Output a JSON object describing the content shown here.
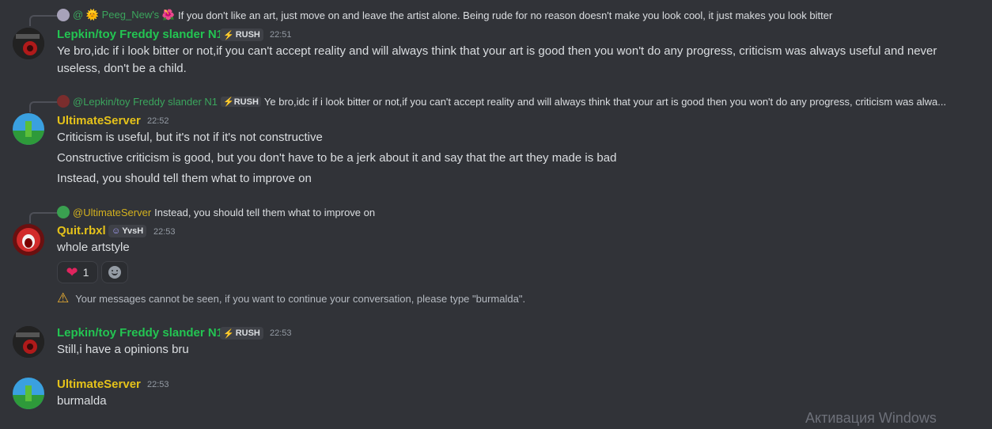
{
  "messages": [
    {
      "reply": {
        "mention": "@ 🌞 Peeg_New's 🌺",
        "text": "If you don't like an art, just move on and leave the artist alone. Being rude for no reason doesn't make you look cool, it just makes you look bitter"
      },
      "author": "Lepkin/toy Freddy slander N1",
      "tag": "RUSH",
      "time": "22:51",
      "lines": [
        "Ye bro,idc if i look bitter or not,if you can't accept reality and will always think that your art is good then you won't do any progress, criticism was always useful and never useless, don't be a child."
      ]
    },
    {
      "reply": {
        "mention": "@Lepkin/toy Freddy slander N1",
        "tag": "RUSH",
        "text": "Ye bro,idc if i look bitter or not,if you can't accept reality and will always think that your art is good then you won't do any progress, criticism was alwa..."
      },
      "author": "UltimateServer",
      "time": "22:52",
      "lines": [
        "Criticism is useful, but it's not if it's not constructive",
        "Constructive criticism is good, but you don't have to be a jerk about it and say that the art they made is bad",
        "Instead, you should tell them what to improve on"
      ]
    },
    {
      "reply": {
        "mention": "@UltimateServer",
        "text": "Instead, you should tell them what to improve on"
      },
      "author": "Quit.rbxl",
      "tag": "YvsH",
      "time": "22:53",
      "lines": [
        "whole artstyle"
      ],
      "reactions": [
        {
          "emoji": "heart-emoji",
          "count": "1"
        }
      ],
      "system_notice": "Your messages cannot be seen, if you want to continue your conversation, please type \"burmalda\"."
    },
    {
      "author": "Lepkin/toy Freddy slander N1",
      "tag": "RUSH",
      "time": "22:53",
      "lines": [
        "Still,i have a opinions bru"
      ]
    },
    {
      "author": "UltimateServer",
      "time": "22:53",
      "lines": [
        "burmalda"
      ]
    }
  ],
  "watermark": "Активация Windows",
  "colors": {
    "background": "#313338",
    "green_name": "#23c552",
    "yellow_name": "#e5c21a",
    "heart": "#e0245e"
  }
}
